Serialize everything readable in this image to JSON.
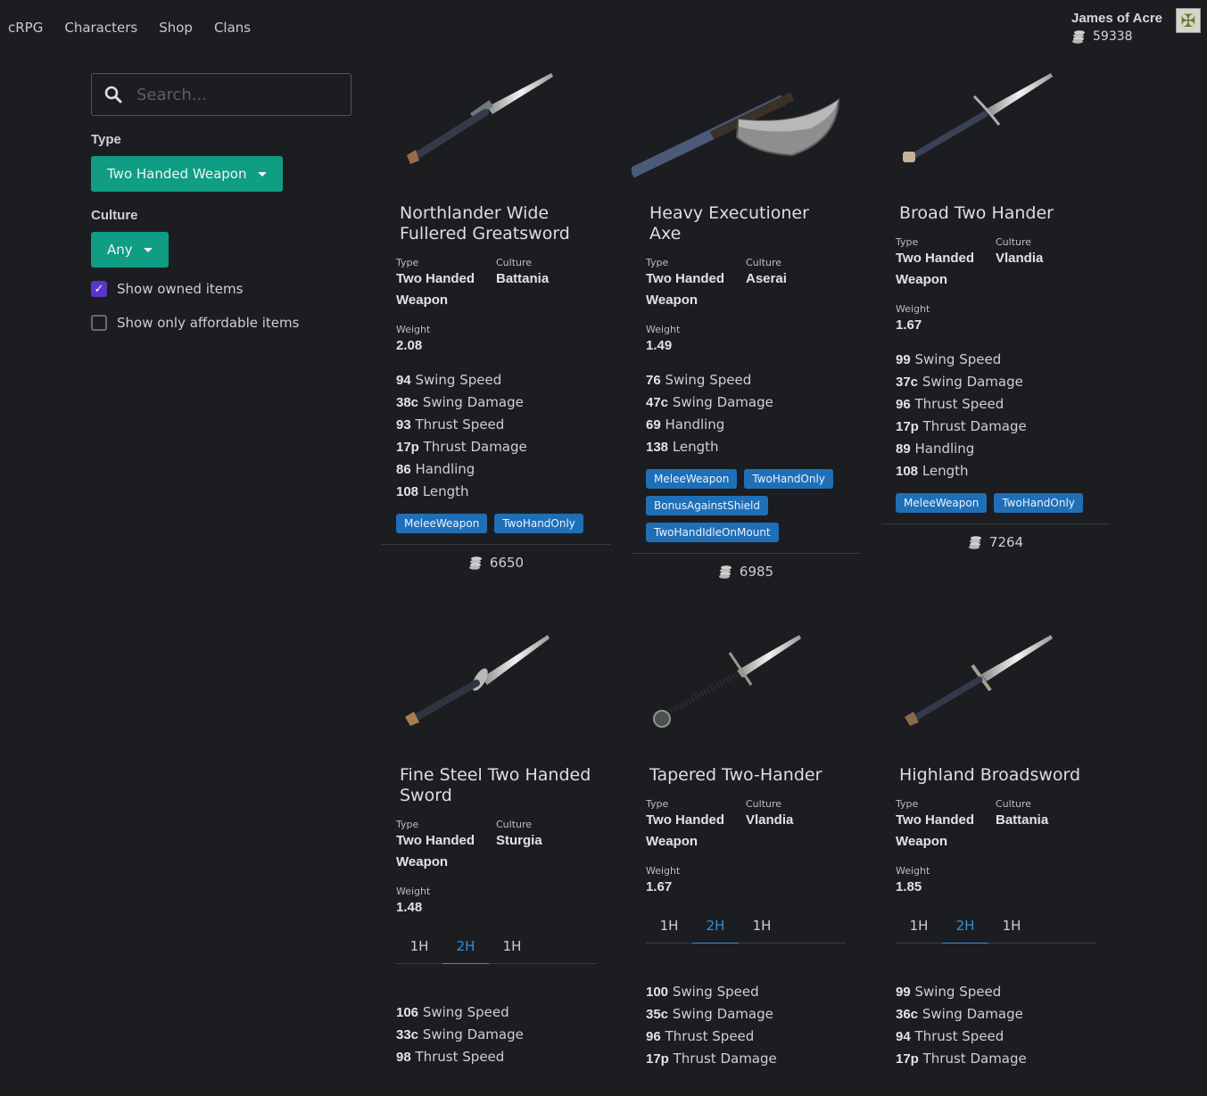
{
  "nav": {
    "brand": "cRPG",
    "links": [
      "Characters",
      "Shop",
      "Clans"
    ]
  },
  "user": {
    "name": "James of Acre",
    "gold": "59338"
  },
  "sidebar": {
    "search_placeholder": "Search...",
    "type_label": "Type",
    "type_value": "Two Handed Weapon",
    "culture_label": "Culture",
    "culture_value": "Any",
    "show_owned": "Show owned items",
    "show_affordable": "Show only affordable items"
  },
  "labels": {
    "type": "Type",
    "culture": "Culture",
    "weight": "Weight"
  },
  "colors": {
    "accent": "#0f9d84",
    "tag": "#1f6fb6",
    "active_tab": "#2f8fe0",
    "checkbox": "#5b35c7",
    "background": "#1c1d20"
  },
  "items": [
    {
      "name": "Northlander Wide Fullered Greatsword",
      "type_l1": "Two Handed",
      "type_l2": "Weapon",
      "culture": "Battania",
      "weight": "2.08",
      "stats": [
        {
          "v": "94",
          "l": "Swing Speed"
        },
        {
          "v": "38c",
          "l": "Swing Damage"
        },
        {
          "v": "93",
          "l": "Thrust Speed"
        },
        {
          "v": "17p",
          "l": "Thrust Damage"
        },
        {
          "v": "86",
          "l": "Handling"
        },
        {
          "v": "108",
          "l": "Length"
        }
      ],
      "tags": [
        "MeleeWeapon",
        "TwoHandOnly"
      ],
      "price": "6650"
    },
    {
      "name": "Heavy Executioner Axe",
      "type_l1": "Two Handed",
      "type_l2": "Weapon",
      "culture": "Aserai",
      "weight": "1.49",
      "stats": [
        {
          "v": "76",
          "l": "Swing Speed"
        },
        {
          "v": "47c",
          "l": "Swing Damage"
        },
        {
          "v": "69",
          "l": "Handling"
        },
        {
          "v": "138",
          "l": "Length"
        }
      ],
      "tags": [
        "MeleeWeapon",
        "TwoHandOnly",
        "BonusAgainstShield",
        "TwoHandIdleOnMount"
      ],
      "price": "6985"
    },
    {
      "name": "Broad Two Hander",
      "type_l1": "Two Handed",
      "type_l2": "Weapon",
      "culture": "Vlandia",
      "weight": "1.67",
      "stats": [
        {
          "v": "99",
          "l": "Swing Speed"
        },
        {
          "v": "37c",
          "l": "Swing Damage"
        },
        {
          "v": "96",
          "l": "Thrust Speed"
        },
        {
          "v": "17p",
          "l": "Thrust Damage"
        },
        {
          "v": "89",
          "l": "Handling"
        },
        {
          "v": "108",
          "l": "Length"
        }
      ],
      "tags": [
        "MeleeWeapon",
        "TwoHandOnly"
      ],
      "price": "7264"
    },
    {
      "name": "Fine Steel Two Handed Sword",
      "type_l1": "Two Handed",
      "type_l2": "Weapon",
      "culture": "Sturgia",
      "weight": "1.48",
      "tabs": [
        "1H",
        "2H",
        "1H"
      ],
      "stats": [
        {
          "v": "106",
          "l": "Swing Speed"
        },
        {
          "v": "33c",
          "l": "Swing Damage"
        },
        {
          "v": "98",
          "l": "Thrust Speed"
        }
      ]
    },
    {
      "name": "Tapered Two-Hander",
      "type_l1": "Two Handed",
      "type_l2": "Weapon",
      "culture": "Vlandia",
      "weight": "1.67",
      "tabs": [
        "1H",
        "2H",
        "1H"
      ],
      "stats": [
        {
          "v": "100",
          "l": "Swing Speed"
        },
        {
          "v": "35c",
          "l": "Swing Damage"
        },
        {
          "v": "96",
          "l": "Thrust Speed"
        },
        {
          "v": "17p",
          "l": "Thrust Damage"
        }
      ]
    },
    {
      "name": "Highland Broadsword",
      "type_l1": "Two Handed",
      "type_l2": "Weapon",
      "culture": "Battania",
      "weight": "1.85",
      "tabs": [
        "1H",
        "2H",
        "1H"
      ],
      "stats": [
        {
          "v": "99",
          "l": "Swing Speed"
        },
        {
          "v": "36c",
          "l": "Swing Damage"
        },
        {
          "v": "94",
          "l": "Thrust Speed"
        },
        {
          "v": "17p",
          "l": "Thrust Damage"
        }
      ]
    }
  ]
}
